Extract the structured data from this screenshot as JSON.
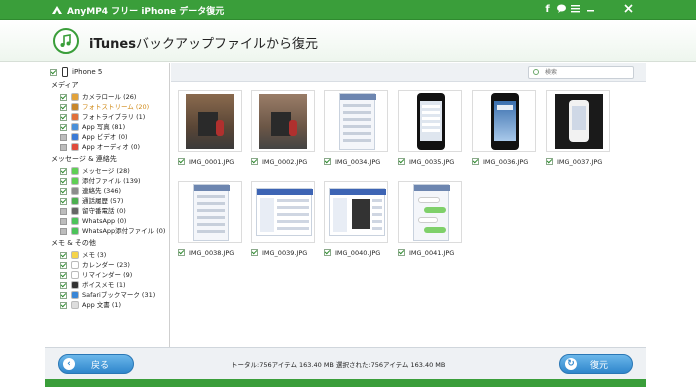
{
  "window": {
    "title": "AnyMP4 フリー iPhone データ復元",
    "icons": [
      "facebook-icon",
      "chat-icon",
      "menu-icon",
      "minimize-icon",
      "close-icon"
    ]
  },
  "header": {
    "heading_bold": "iTunes",
    "heading_rest": "バックアップファイルから復元"
  },
  "sidebar": {
    "device": "iPhone 5",
    "sections": [
      {
        "title": "メディア",
        "items": [
          {
            "label": "カメラロール (26)",
            "checked": true,
            "color": "#e2a23a"
          },
          {
            "label": "フォトストリーム (20)",
            "checked": true,
            "color": "#c8862b",
            "highlight": true
          },
          {
            "label": "フォトライブラリ (1)",
            "checked": true,
            "color": "#e0703a"
          },
          {
            "label": "App 写真 (81)",
            "checked": true,
            "color": "#4a90d9"
          },
          {
            "label": "App ビデオ (0)",
            "checked": false,
            "color": "#3b7bd6"
          },
          {
            "label": "App オーディオ (0)",
            "checked": false,
            "color": "#e04b3a"
          }
        ]
      },
      {
        "title": "メッセージ & 連絡先",
        "items": [
          {
            "label": "メッセージ (28)",
            "checked": true,
            "color": "#5fcf55"
          },
          {
            "label": "添付ファイル (139)",
            "checked": true,
            "color": "#5fcf55"
          },
          {
            "label": "連絡先 (346)",
            "checked": true,
            "color": "#8c8c8c"
          },
          {
            "label": "通話履歴 (57)",
            "checked": true,
            "color": "#4caf50"
          },
          {
            "label": "留守番電話 (0)",
            "checked": false,
            "color": "#666666"
          },
          {
            "label": "WhatsApp (0)",
            "checked": false,
            "color": "#4cc35a"
          },
          {
            "label": "WhatsApp添付ファイル (0)",
            "checked": false,
            "color": "#4cc35a"
          }
        ]
      },
      {
        "title": "メモ & その他",
        "items": [
          {
            "label": "メモ (3)",
            "checked": true,
            "color": "#f5d44a"
          },
          {
            "label": "カレンダー (23)",
            "checked": true,
            "color": "#ffffff"
          },
          {
            "label": "リマインダー (9)",
            "checked": true,
            "color": "#ffffff"
          },
          {
            "label": "ボイスメモ (1)",
            "checked": true,
            "color": "#333333"
          },
          {
            "label": "Safariブックマーク (31)",
            "checked": true,
            "color": "#3a86d6"
          },
          {
            "label": "App 文書 (1)",
            "checked": true,
            "color": "#dddddd"
          }
        ]
      }
    ]
  },
  "search": {
    "placeholder": "検索"
  },
  "thumbnails": [
    {
      "name": "IMG_0001.JPG",
      "kind": "photo-office"
    },
    {
      "name": "IMG_0002.JPG",
      "kind": "photo-office2"
    },
    {
      "name": "IMG_0034.JPG",
      "kind": "screen-list"
    },
    {
      "name": "IMG_0035.JPG",
      "kind": "phone-settings"
    },
    {
      "name": "IMG_0036.JPG",
      "kind": "phone-lock"
    },
    {
      "name": "IMG_0037.JPG",
      "kind": "phone-white"
    },
    {
      "name": "IMG_0038.JPG",
      "kind": "screen-list"
    },
    {
      "name": "IMG_0039.JPG",
      "kind": "screen-web"
    },
    {
      "name": "IMG_0040.JPG",
      "kind": "screen-web2"
    },
    {
      "name": "IMG_0041.JPG",
      "kind": "screen-chat"
    }
  ],
  "footer": {
    "back_label": "戻る",
    "recover_label": "復元",
    "stats": "トータル:756アイテム 163.40 MB   選択された:756アイテム 163.40 MB"
  },
  "colors": {
    "accent": "#3a9e3a",
    "button": "#2f86cc"
  }
}
